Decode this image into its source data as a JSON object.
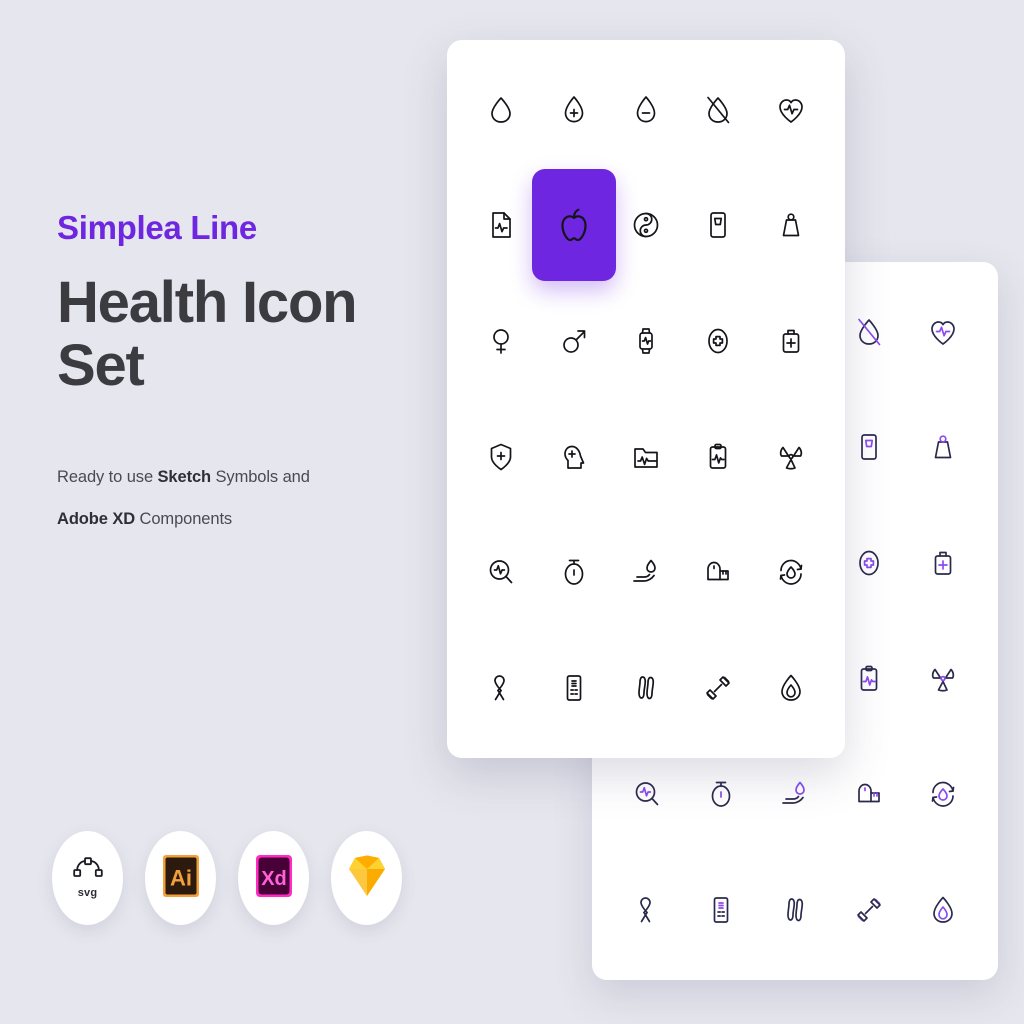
{
  "page": {
    "background_color": "#e6e6ee",
    "accent_color": "#6f26e0",
    "headline_color": "#3b3b40",
    "back_card_stroke_color": "#2b2a4d",
    "back_card_accent_color": "#8a4bf0"
  },
  "left_panel": {
    "eyebrow": "Simplea Line",
    "headline": "Health Icon Set",
    "subcopy_line1_prefix": "Ready to use ",
    "subcopy_line1_strong": "Sketch",
    "subcopy_line1_suffix": " Symbols and",
    "subcopy_line2_strong": "Adobe XD",
    "subcopy_line2_suffix": " Components"
  },
  "badges": [
    {
      "name": "svg-badge",
      "label": "svg",
      "icon": "bezier-pen-icon"
    },
    {
      "name": "illustrator-badge",
      "label": "Ai",
      "icon": "adobe-illustrator-icon"
    },
    {
      "name": "xd-badge",
      "label": "Xd",
      "icon": "adobe-xd-icon"
    },
    {
      "name": "sketch-badge",
      "label": "",
      "icon": "sketch-diamond-icon"
    }
  ],
  "front_card": {
    "columns": 5,
    "rows": 6,
    "highlight_index": 6,
    "icons": [
      "blood-drop-icon",
      "drop-plus-icon",
      "drop-minus-icon",
      "drop-off-icon",
      "heart-pulse-icon",
      "medical-report-icon",
      "apple-icon",
      "yin-yang-icon",
      "water-dispenser-icon",
      "weight-icon",
      "female-symbol-icon",
      "male-symbol-icon",
      "smartwatch-pulse-icon",
      "pill-plus-icon",
      "medical-bag-icon",
      "shield-plus-icon",
      "mental-health-icon",
      "folder-pulse-icon",
      "clipboard-pulse-icon",
      "radiation-icon",
      "pulse-search-icon",
      "stopwatch-icon",
      "hand-drop-icon",
      "measuring-tape-icon",
      "drop-refresh-icon",
      "awareness-ribbon-icon",
      "eye-chart-icon",
      "footprints-icon",
      "dumbbell-icon",
      "flame-icon"
    ]
  },
  "back_card": {
    "columns": 5,
    "rows": 6,
    "icons": [
      "blood-drop-icon",
      "drop-plus-icon",
      "drop-minus-icon",
      "drop-off-icon",
      "heart-pulse-icon",
      "medical-report-icon",
      "apple-icon",
      "yin-yang-icon",
      "water-dispenser-icon",
      "weight-icon",
      "female-symbol-icon",
      "male-symbol-icon",
      "smartwatch-pulse-icon",
      "pill-plus-icon",
      "medical-bag-icon",
      "shield-plus-icon",
      "mental-health-icon",
      "folder-pulse-icon",
      "clipboard-pulse-icon",
      "radiation-icon",
      "pulse-search-icon",
      "stopwatch-icon",
      "hand-drop-icon",
      "measuring-tape-icon",
      "drop-refresh-icon",
      "awareness-ribbon-icon",
      "eye-chart-icon",
      "footprints-icon",
      "dumbbell-icon",
      "flame-icon"
    ]
  }
}
